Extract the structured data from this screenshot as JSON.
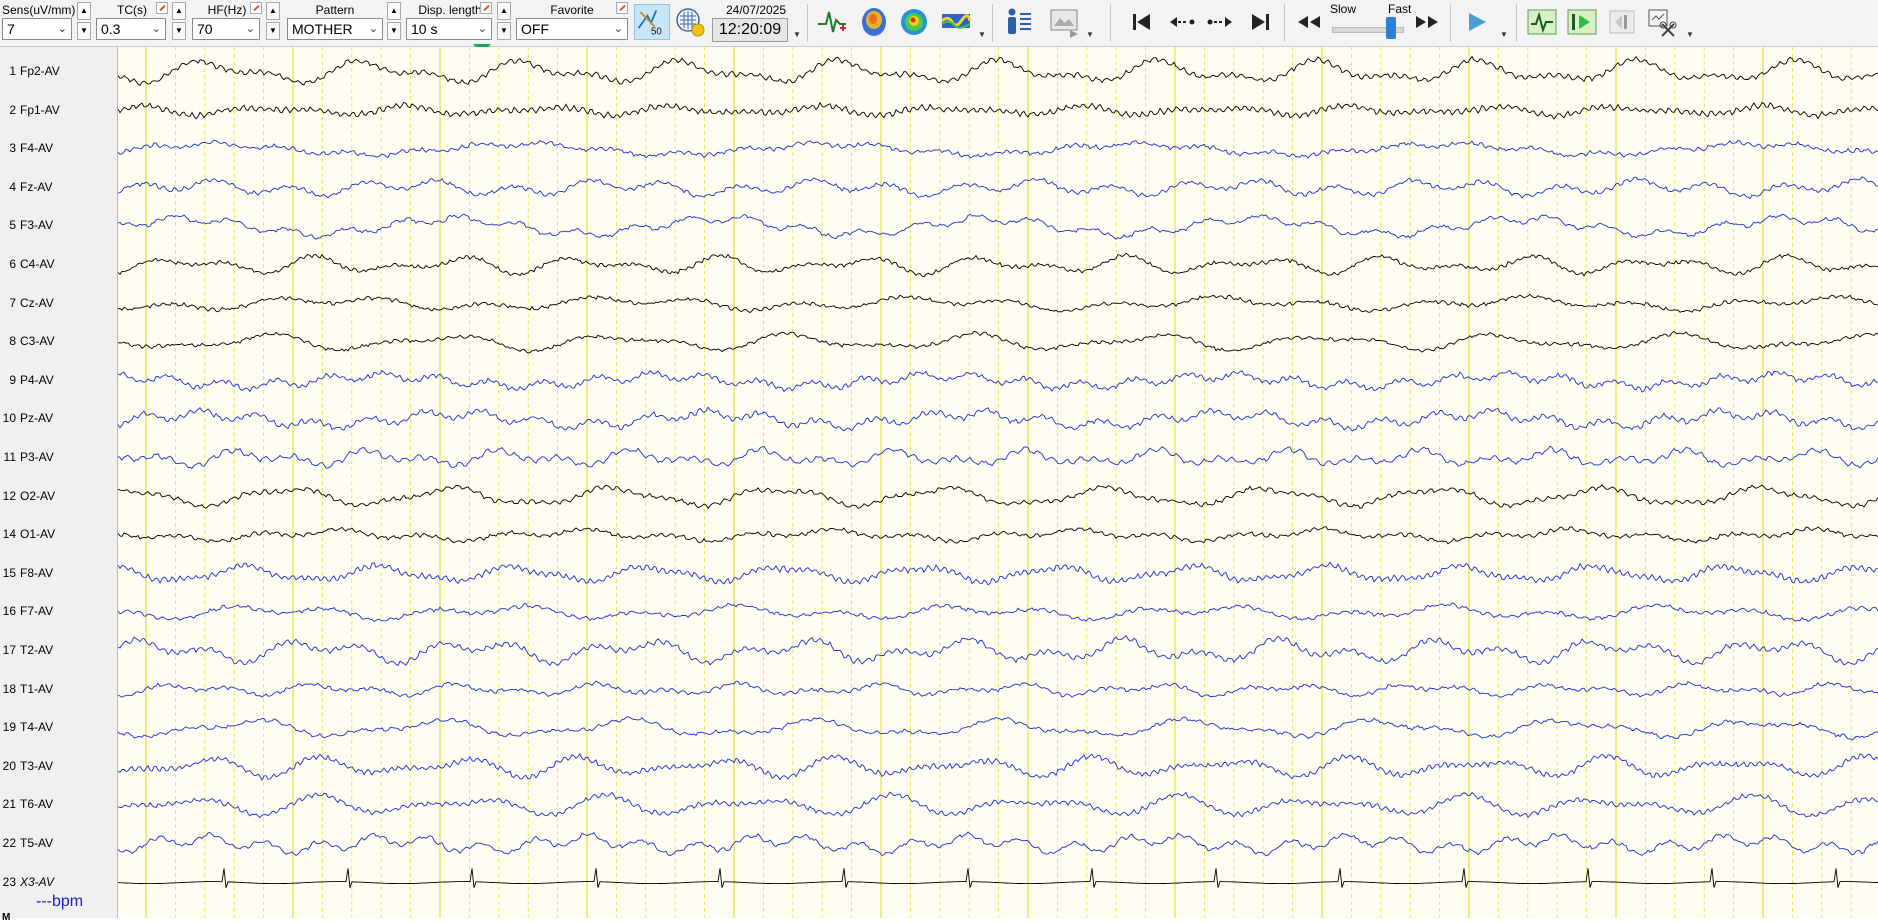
{
  "toolbar": {
    "sens": {
      "label": "Sens(uV/mm)",
      "value": "7"
    },
    "tc": {
      "label": "TC(s)",
      "value": "0.3"
    },
    "hf": {
      "label": "HF(Hz)",
      "value": "70"
    },
    "pattern": {
      "label": "Pattern",
      "value": "MOTHER"
    },
    "disp_length": {
      "label": "Disp. length",
      "value": "10 s"
    },
    "favorite": {
      "label": "Favorite",
      "value": "OFF"
    },
    "notch_badge": "50",
    "date": "24/07/2025",
    "time": "12:20:09",
    "speed_slow": "Slow",
    "speed_fast": "Fast"
  },
  "channels": [
    {
      "num": "1",
      "name": "Fp2-AV",
      "color": "#000000"
    },
    {
      "num": "2",
      "name": "Fp1-AV",
      "color": "#000000"
    },
    {
      "num": "3",
      "name": "F4-AV",
      "color": "#1a2fd0"
    },
    {
      "num": "4",
      "name": "Fz-AV",
      "color": "#1a2fd0"
    },
    {
      "num": "5",
      "name": "F3-AV",
      "color": "#1a2fd0"
    },
    {
      "num": "6",
      "name": "C4-AV",
      "color": "#000000"
    },
    {
      "num": "7",
      "name": "Cz-AV",
      "color": "#000000"
    },
    {
      "num": "8",
      "name": "C3-AV",
      "color": "#000000"
    },
    {
      "num": "9",
      "name": "P4-AV",
      "color": "#1a2fd0"
    },
    {
      "num": "10",
      "name": "Pz-AV",
      "color": "#1a2fd0"
    },
    {
      "num": "11",
      "name": "P3-AV",
      "color": "#1a2fd0"
    },
    {
      "num": "12",
      "name": "O2-AV",
      "color": "#000000"
    },
    {
      "num": "14",
      "name": "O1-AV",
      "color": "#000000"
    },
    {
      "num": "15",
      "name": "F8-AV",
      "color": "#1a2fd0"
    },
    {
      "num": "16",
      "name": "F7-AV",
      "color": "#1a2fd0"
    },
    {
      "num": "17",
      "name": "T2-AV",
      "color": "#1a2fd0"
    },
    {
      "num": "18",
      "name": "T1-AV",
      "color": "#1a2fd0"
    },
    {
      "num": "19",
      "name": "T4-AV",
      "color": "#1a2fd0"
    },
    {
      "num": "20",
      "name": "T3-AV",
      "color": "#1a2fd0"
    },
    {
      "num": "21",
      "name": "T6-AV",
      "color": "#1a2fd0"
    },
    {
      "num": "22",
      "name": "T5-AV",
      "color": "#1a2fd0"
    },
    {
      "num": "23",
      "name": "X3-AV",
      "color": "#000000"
    }
  ],
  "heart_rate": "---bpm",
  "bottom_row_label": "M",
  "colors": {
    "trace_background": "#fffdf1",
    "grid_line": "#e8df3a",
    "trace_black": "#000000",
    "trace_blue": "#1a2fd0",
    "marker": "#17a84a"
  }
}
